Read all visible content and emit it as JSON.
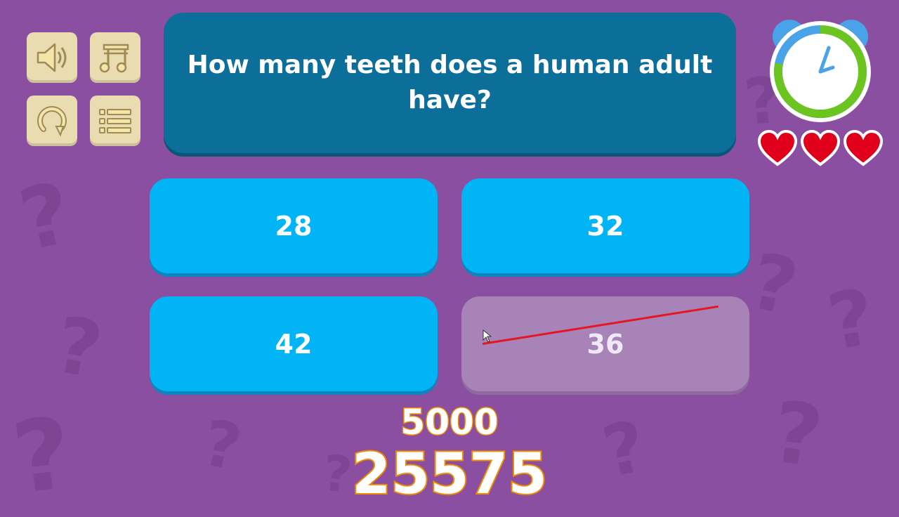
{
  "question": {
    "text": "How many teeth does a human adult have?"
  },
  "answers": [
    {
      "label": "28",
      "eliminated": false
    },
    {
      "label": "32",
      "eliminated": false
    },
    {
      "label": "42",
      "eliminated": false
    },
    {
      "label": "36",
      "eliminated": true
    }
  ],
  "scores": {
    "bonus": "5000",
    "total": "25575"
  },
  "lives": {
    "count": 3
  },
  "timer": {
    "remaining_fraction": 0.78
  },
  "controls": {
    "sound_icon": "speaker-icon",
    "music_icon": "music-note-icon",
    "restart_icon": "restart-icon",
    "menu_icon": "menu-icon"
  },
  "colors": {
    "background": "#8a4fa0",
    "question_box": "#0c6f9a",
    "answer_button": "#00b4f6",
    "eliminated_answer": "#a783b7",
    "strike_line": "#e51620",
    "heart": "#e0001b",
    "score_outline": "#f08a00"
  }
}
